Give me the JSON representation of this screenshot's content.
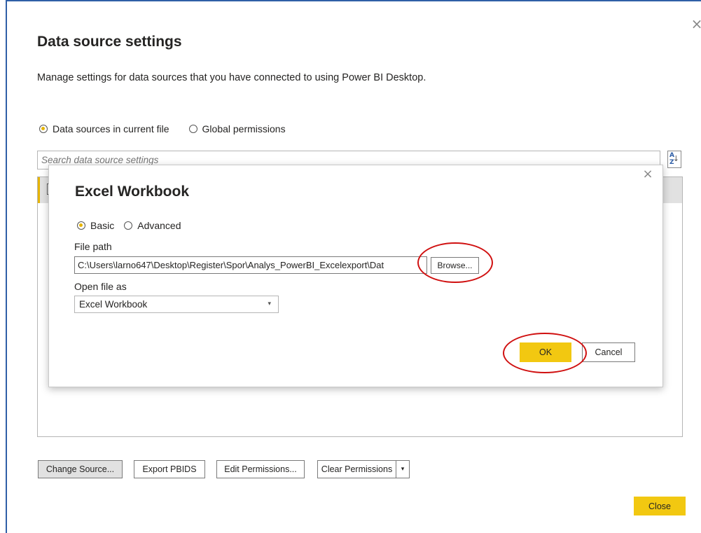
{
  "outer_dialog": {
    "title": "Data source settings",
    "description": "Manage settings for data sources that you have connected to using Power BI Desktop.",
    "close_icon": "×",
    "scope_options": [
      {
        "label": "Data sources in current file",
        "selected": true
      },
      {
        "label": "Global permissions",
        "selected": false
      }
    ],
    "search_placeholder": "Search data source settings",
    "sort_icon_text": "A Z",
    "sort_icon_arrow": "↓",
    "buttons": {
      "change_source": "Change Source...",
      "export_pbids": "Export PBIDS",
      "edit_permissions": "Edit Permissions...",
      "clear_permissions": "Clear Permissions",
      "clear_permissions_dropdown": "▾",
      "close": "Close"
    }
  },
  "inner_dialog": {
    "title": "Excel Workbook",
    "close_icon": "×",
    "mode_options": [
      {
        "label": "Basic",
        "selected": true
      },
      {
        "label": "Advanced",
        "selected": false
      }
    ],
    "file_path_label": "File path",
    "file_path_value": "C:\\Users\\larno647\\Desktop\\Register\\Spor\\Analys_PowerBI_Excelexport\\Dat",
    "browse_label": "Browse...",
    "open_file_as_label": "Open file as",
    "open_file_as_value": "Excel Workbook",
    "open_file_chevron": "▾",
    "ok_label": "OK",
    "cancel_label": "Cancel"
  },
  "colors": {
    "accent_yellow": "#f2c811",
    "window_border": "#2f5fa7",
    "annotation_red": "#d01010"
  }
}
